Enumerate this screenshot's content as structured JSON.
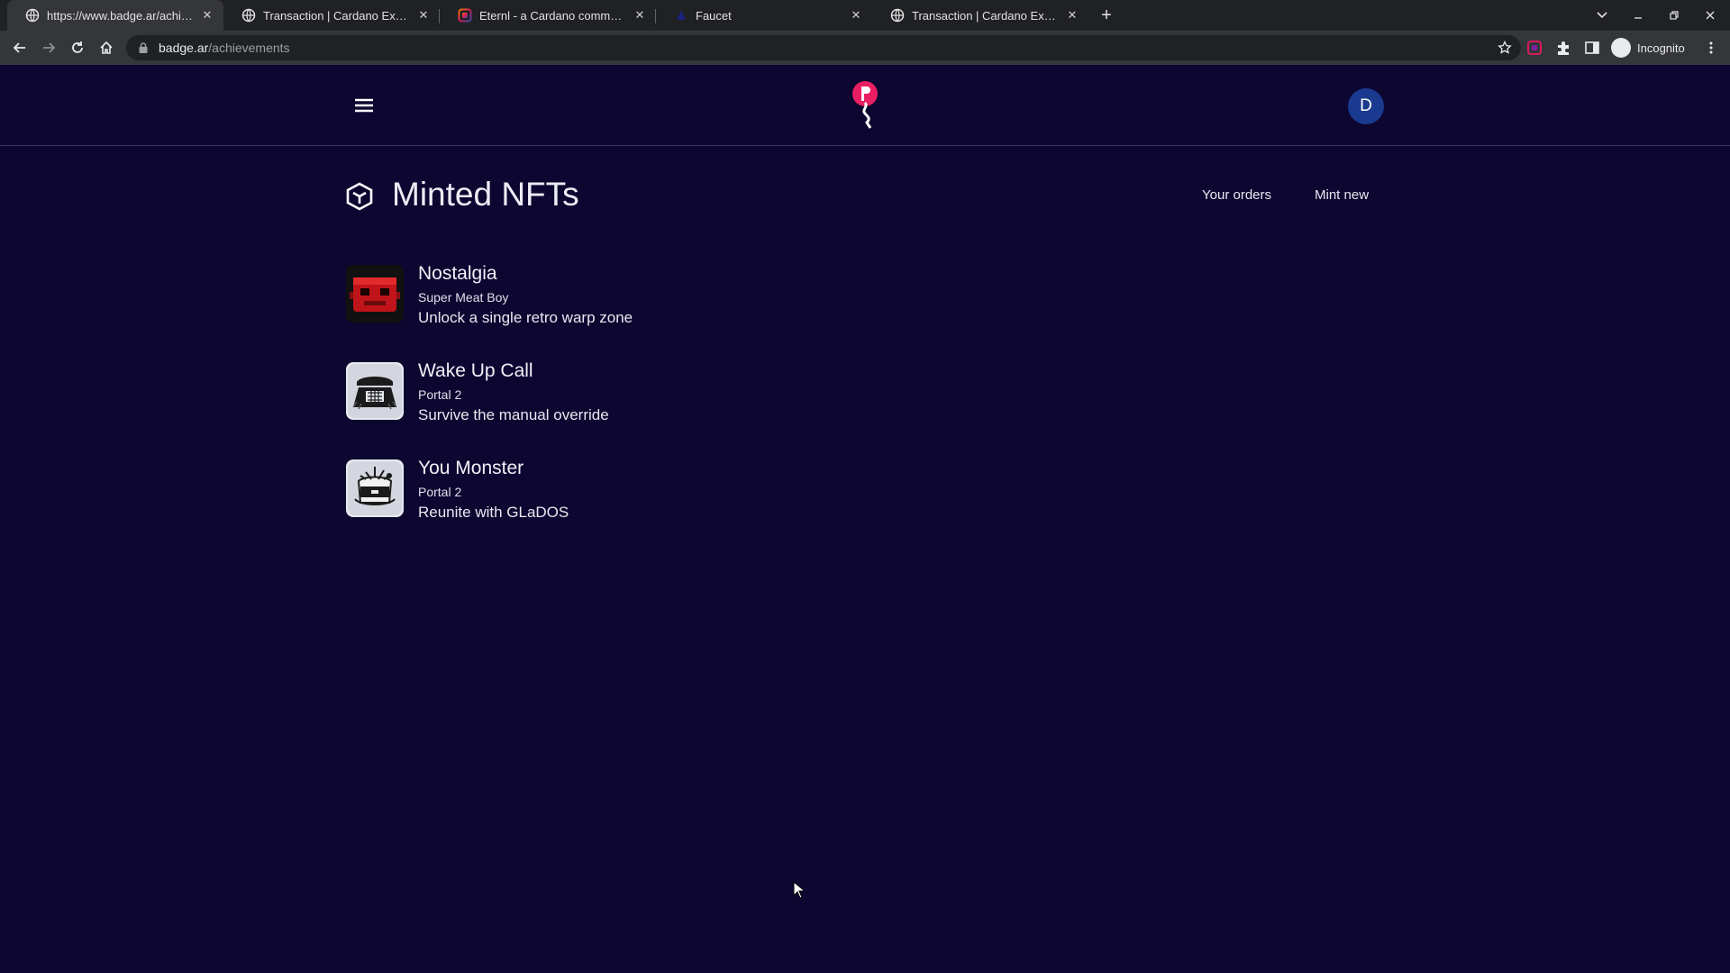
{
  "browser": {
    "tabs": [
      {
        "title": "https://www.badge.ar/achievements",
        "favicon": "globe-icon",
        "active": true
      },
      {
        "title": "Transaction | Cardano Explorer",
        "favicon": "globe-icon",
        "active": false
      },
      {
        "title": "Eternl - a Cardano community wallet",
        "favicon": "eternl-icon",
        "active": false
      },
      {
        "title": "Faucet",
        "favicon": "faucet-icon",
        "active": false
      },
      {
        "title": "Transaction | Cardano Explorer",
        "favicon": "globe-icon",
        "active": false
      }
    ],
    "url_host": "badge.ar",
    "url_path": "/achievements",
    "profile_label": "Incognito"
  },
  "header": {
    "avatar_initial": "D",
    "brand_color": "#e91e63"
  },
  "page": {
    "title": "Minted NFTs",
    "actions": {
      "orders_label": "Your orders",
      "mint_label": "Mint new"
    }
  },
  "nfts": [
    {
      "name": "Nostalgia",
      "game": "Super Meat Boy",
      "description": "Unlock a single retro warp zone",
      "icon": "meat-boy-icon"
    },
    {
      "name": "Wake Up Call",
      "game": "Portal 2",
      "description": "Survive the manual override",
      "icon": "telephone-icon"
    },
    {
      "name": "You Monster",
      "game": "Portal 2",
      "description": "Reunite with GLaDOS",
      "icon": "glados-icon"
    }
  ],
  "colors": {
    "background": "#0c0630",
    "avatar": "#1a3a8f"
  }
}
